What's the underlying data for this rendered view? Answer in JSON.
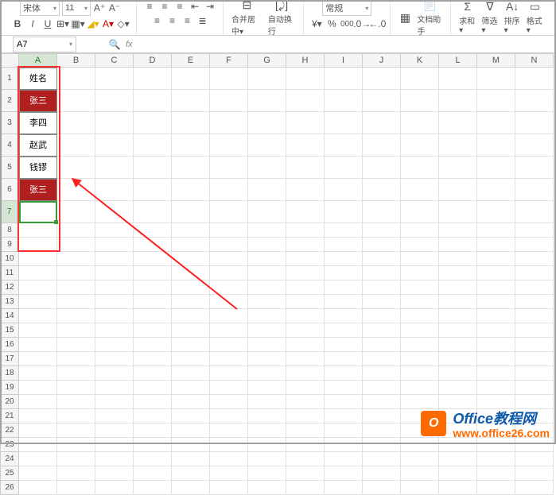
{
  "ribbon": {
    "font_name": "宋体",
    "font_size": "11",
    "bold": "B",
    "italic": "I",
    "underline": "U",
    "merge": "合并居中",
    "wrap": "自动换行",
    "num_format": "常规",
    "doc_helper": "文档助手",
    "sum": "求和",
    "filter": "筛选",
    "sort": "排序",
    "format": "格式"
  },
  "namebox": {
    "ref": "A7",
    "fx": "fx"
  },
  "columns": [
    "A",
    "B",
    "C",
    "D",
    "E",
    "F",
    "G",
    "H",
    "I",
    "J",
    "K",
    "L",
    "M",
    "N"
  ],
  "rows": [
    "1",
    "2",
    "3",
    "4",
    "5",
    "6",
    "7",
    "8",
    "9",
    "10",
    "11",
    "12",
    "13",
    "14",
    "15",
    "16",
    "17",
    "18",
    "19",
    "20",
    "21",
    "22",
    "23",
    "24",
    "25",
    "26"
  ],
  "data": {
    "header": "姓名",
    "r2": "张三",
    "r3": "李四",
    "r4": "赵武",
    "r5": "钱镠",
    "r6": "张三"
  },
  "highlight_rows": [
    2,
    6
  ],
  "active_cell": "A7",
  "watermark": {
    "title": "Office教程网",
    "url": "www.office26.com",
    "badge": "O"
  }
}
